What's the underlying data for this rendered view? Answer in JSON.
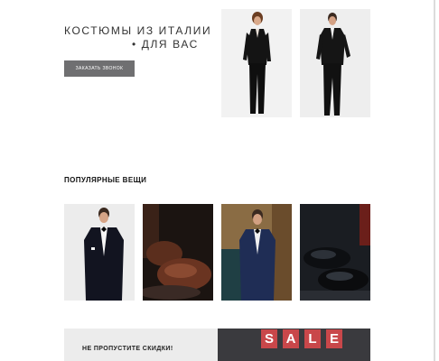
{
  "hero": {
    "title_line1": "КОСТЮМЫ ИЗ ИТАЛИИ",
    "title_line2": "• ДЛЯ ВАС",
    "cta_label": "ЗАКАЗАТЬ ЗВОНОК"
  },
  "popular": {
    "title": "ПОПУЛЯРНЫЕ ВЕЩИ",
    "items": [
      {
        "image": "tuxedo-man-photo"
      },
      {
        "image": "brown-oxford-shoes-photo"
      },
      {
        "image": "blue-suit-man-photo"
      },
      {
        "image": "black-shoes-photo"
      }
    ]
  },
  "promo": {
    "text": "НЕ ПРОПУСТИТЕ СКИДКИ!",
    "sale_letters": [
      "S",
      "A",
      "L",
      "E"
    ]
  },
  "colors": {
    "button": "#6f6f71",
    "sale_tile": "#c9474a",
    "promo_bg": "#ececec",
    "promo_dark": "#3a3a3e"
  }
}
